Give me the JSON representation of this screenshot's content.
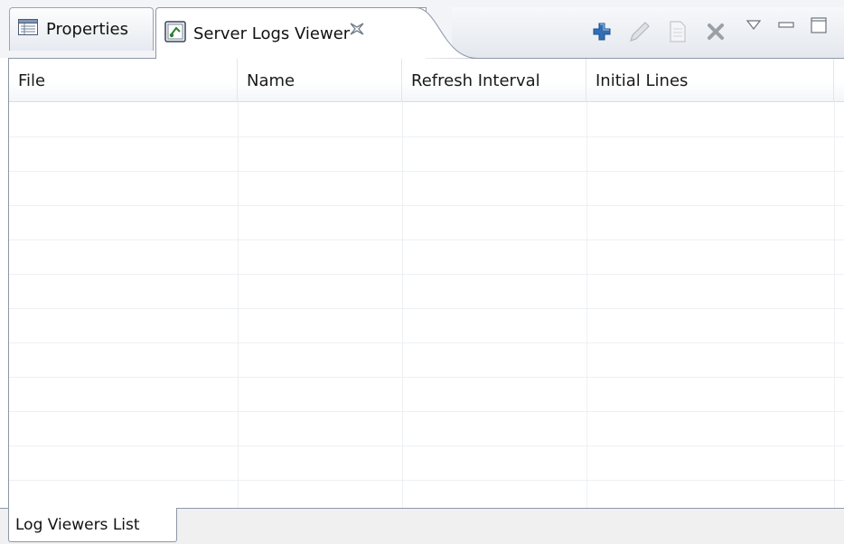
{
  "tabs": {
    "properties": {
      "label": "Properties",
      "icon": "properties-table-icon"
    },
    "server_logs": {
      "label": "Server Logs Viewer",
      "icon": "server-logs-icon",
      "close_icon": "close-icon"
    }
  },
  "toolbar": {
    "buttons": [
      {
        "name": "add-icon",
        "color": "#2f6fb7"
      },
      {
        "name": "edit-pencil-icon",
        "color": "#b8bcc2"
      },
      {
        "name": "copy-document-icon",
        "color": "#c3c6cb"
      },
      {
        "name": "delete-icon",
        "color": "#9aa0a8"
      },
      {
        "name": "view-menu-chevron-icon",
        "color": "#6b7380"
      },
      {
        "name": "minimize-icon",
        "color": "#6b7380"
      },
      {
        "name": "maximize-icon",
        "color": "#6b7380"
      }
    ]
  },
  "table": {
    "columns": [
      {
        "label": "File"
      },
      {
        "label": "Name"
      },
      {
        "label": "Refresh Interval"
      },
      {
        "label": "Initial Lines"
      }
    ],
    "rows": []
  },
  "bottom_tab": {
    "label": "Log Viewers List"
  },
  "colors": {
    "border": "#8c97a8",
    "grid": "#edf0f3",
    "accent": "#2f6fb7"
  }
}
